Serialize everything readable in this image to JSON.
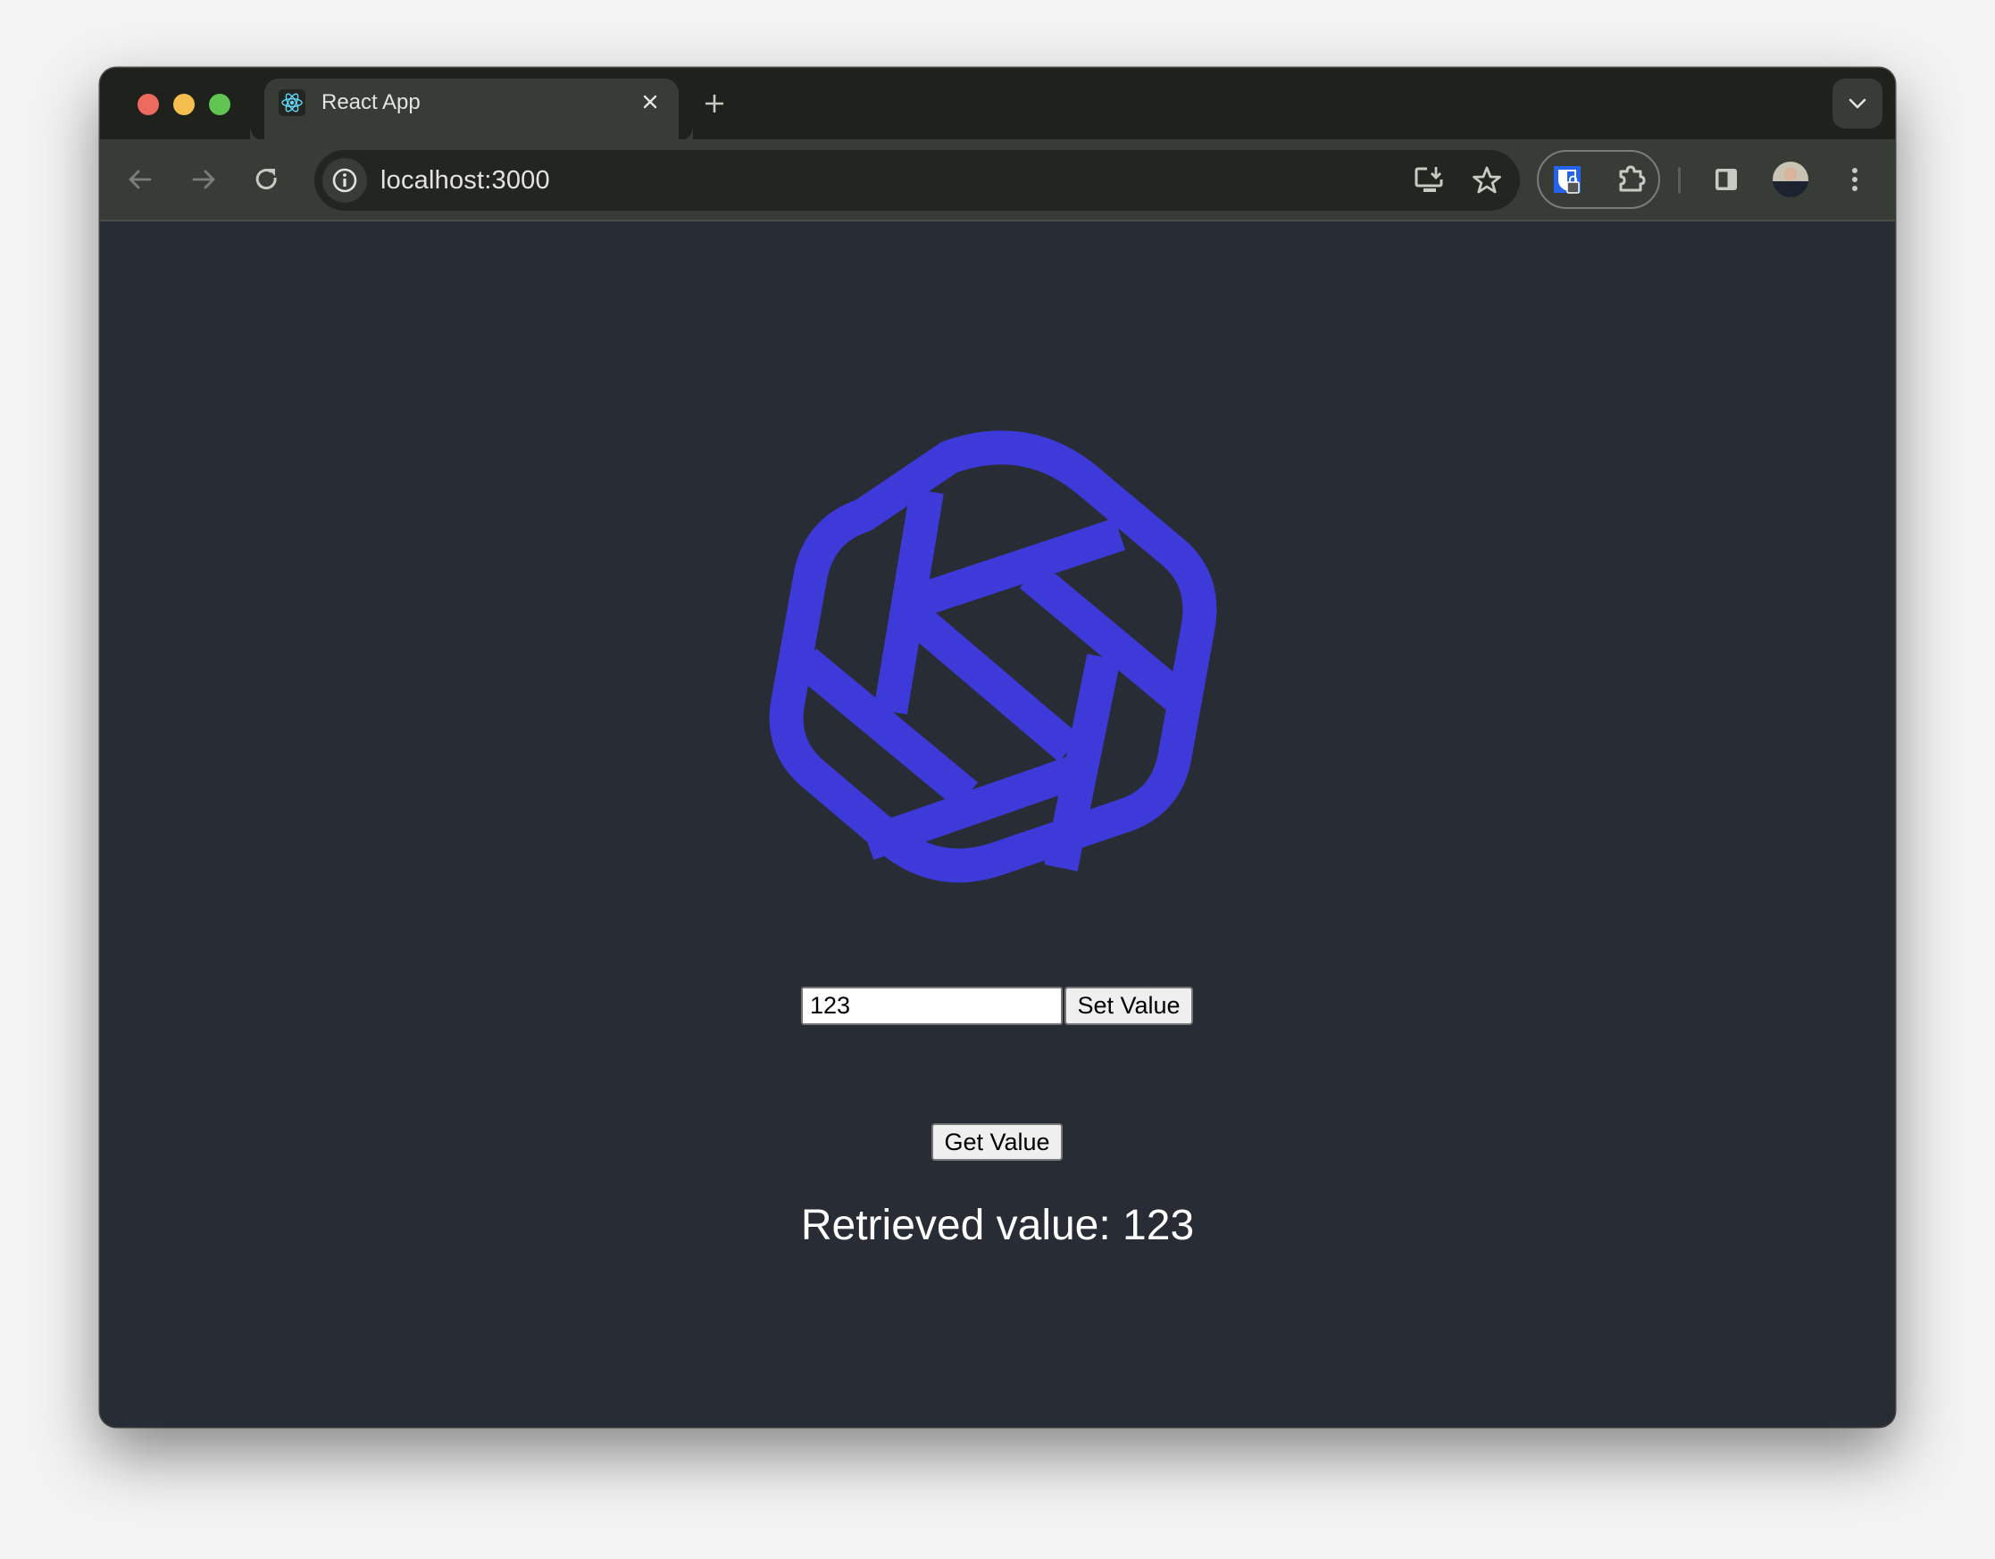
{
  "browser": {
    "window_controls": [
      "close",
      "minimize",
      "maximize"
    ],
    "tabs": [
      {
        "title": "React App",
        "favicon": "react-logo-icon",
        "active": true
      }
    ],
    "new_tab_icon": "plus-icon",
    "tab_search_icon": "chevron-down-icon",
    "address_bar": {
      "url": "localhost:3000",
      "site_info_icon": "info-icon",
      "actions": [
        "install-app-icon",
        "bookmark-star-icon"
      ]
    },
    "extensions": [
      "bitwarden-icon",
      "puzzle-extensions-icon"
    ],
    "toolbar_right": [
      "side-panel-icon",
      "profile-avatar",
      "more-menu-icon"
    ]
  },
  "page": {
    "logo": {
      "name": "hexagon-logo",
      "color": "#3e3ad9"
    },
    "input": {
      "value": "123",
      "placeholder": ""
    },
    "set_button_label": "Set Value",
    "get_button_label": "Get Value",
    "result_text": "Retrieved value: 123"
  },
  "colors": {
    "page_background": "#282c34",
    "titlebar": "#1e211c",
    "toolbar": "#383c36",
    "omnibox": "#232620"
  }
}
